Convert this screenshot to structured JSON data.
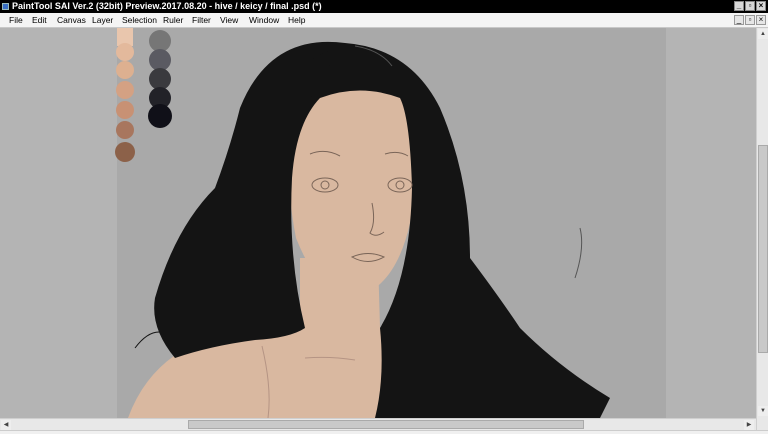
{
  "window": {
    "title": "PaintTool SAI Ver.2 (32bit) Preview.2017.08.20 - hive / keicy / final .psd (*)",
    "controls": [
      "_",
      "▫",
      "×"
    ]
  },
  "menu": {
    "items": [
      "File",
      "Edit",
      "Canvas",
      "Layer",
      "Selection",
      "Ruler",
      "Filter",
      "View",
      "Window",
      "Help"
    ]
  },
  "mdi_controls": [
    "_",
    "▫",
    "×"
  ],
  "canvas": {
    "background": "#b4b4b4",
    "paper": "#a3a3a3",
    "skin": "#d9b8a0",
    "hair": "#141414",
    "line": "#7a6558"
  },
  "swatches": {
    "skin_tones": [
      "#e9c6ad",
      "#e3b99c",
      "#ddb090",
      "#d4a183",
      "#c89174",
      "#a8765e",
      "#8c6149"
    ],
    "dark_tones": [
      "#767676",
      "#5a5a62",
      "#3a3a3e",
      "#222228",
      "#101018"
    ]
  },
  "scrollbars": {
    "vertical_position": 0.32,
    "horizontal_position": 0.25
  }
}
